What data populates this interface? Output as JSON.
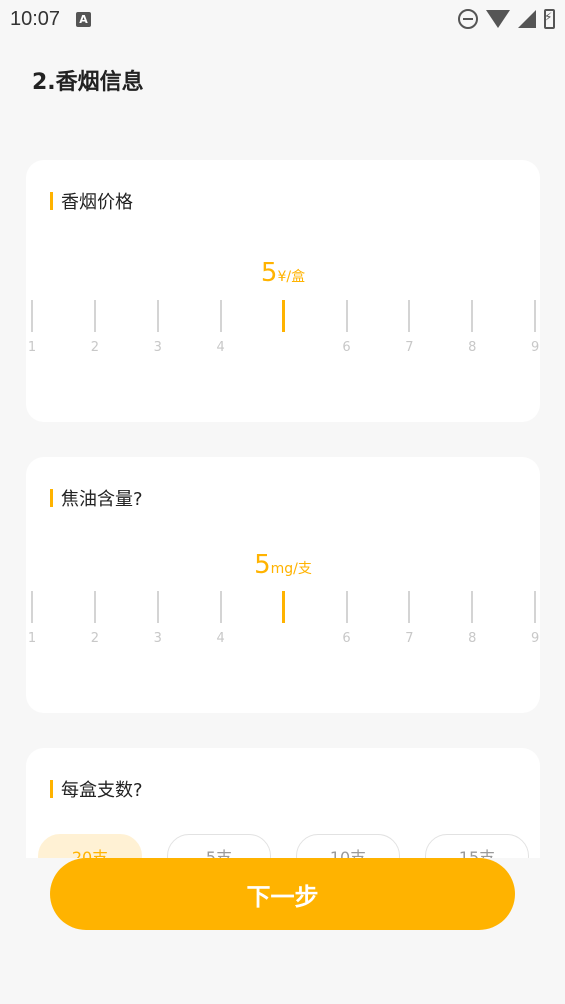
{
  "status": {
    "time": "10:07",
    "a_icon": "A"
  },
  "page": {
    "title": "2.香烟信息"
  },
  "price": {
    "title": "香烟价格",
    "value": "5",
    "unit": "¥/盒",
    "labels": [
      "1",
      "2",
      "3",
      "4",
      "",
      "6",
      "7",
      "8",
      "9"
    ]
  },
  "tar": {
    "title": "焦油含量?",
    "value": "5",
    "unit": "mg/支",
    "labels": [
      "1",
      "2",
      "3",
      "4",
      "",
      "6",
      "7",
      "8",
      "9"
    ]
  },
  "count": {
    "title": "每盒支数?",
    "options": [
      "20支",
      "5支",
      "10支",
      "15支"
    ],
    "selected": "20支"
  },
  "next_label": "下一步",
  "colors": {
    "accent": "#ffb300",
    "chip_selected_bg": "#fff1d4"
  },
  "icons": [
    "do-not-disturb-icon",
    "wifi-icon",
    "signal-icon",
    "battery-charging-icon"
  ]
}
